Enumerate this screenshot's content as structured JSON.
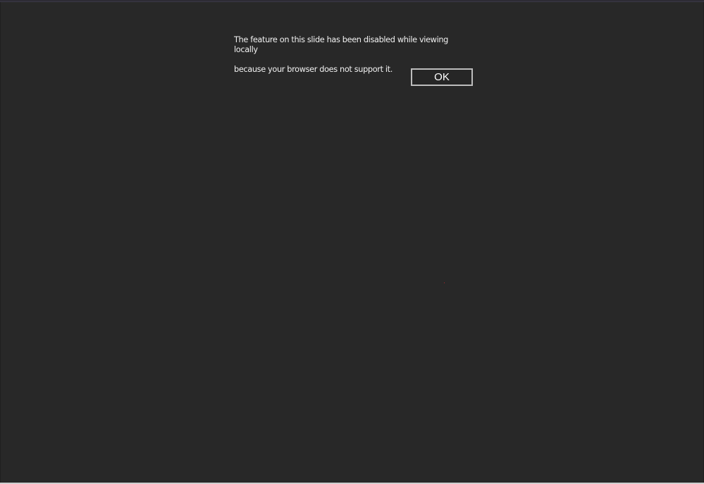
{
  "dialog": {
    "message_line1": "The  feature on this slide has been disabled while viewing locally",
    "message_line2": "because your browser does not support it.",
    "ok_label": "OK"
  },
  "colors": {
    "background": "#282828",
    "text": "#f2f2f2",
    "button_border": "#bdbdbd"
  }
}
